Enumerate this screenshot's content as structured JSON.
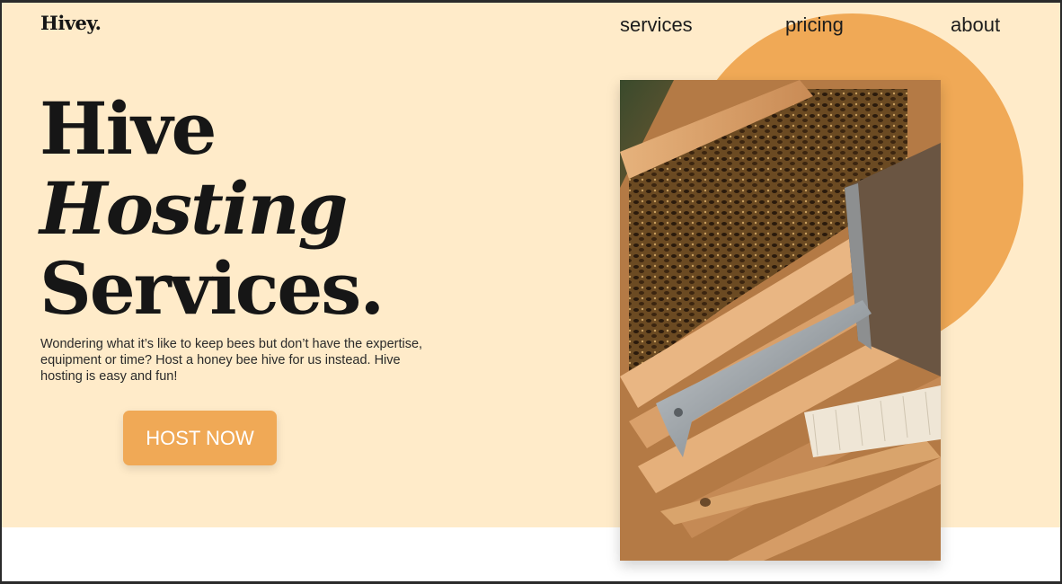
{
  "brand": {
    "logo": "Hivey."
  },
  "nav": {
    "items": [
      "services",
      "pricing",
      "about"
    ]
  },
  "hero": {
    "title_line1": "Hive",
    "title_line2": "Hosting",
    "title_line3": "Services.",
    "description": "Wondering what it’s like to keep bees but don’t have the expertise, equipment or time?  Host a honey bee hive for us instead. Hive hosting is easy and fun!",
    "cta_label": "HOST NOW"
  },
  "colors": {
    "accent": "#f0a956",
    "background": "#ffebc9",
    "text": "#161616"
  },
  "image": {
    "subject": "beehive-frames-with-hive-tool-and-brush"
  }
}
